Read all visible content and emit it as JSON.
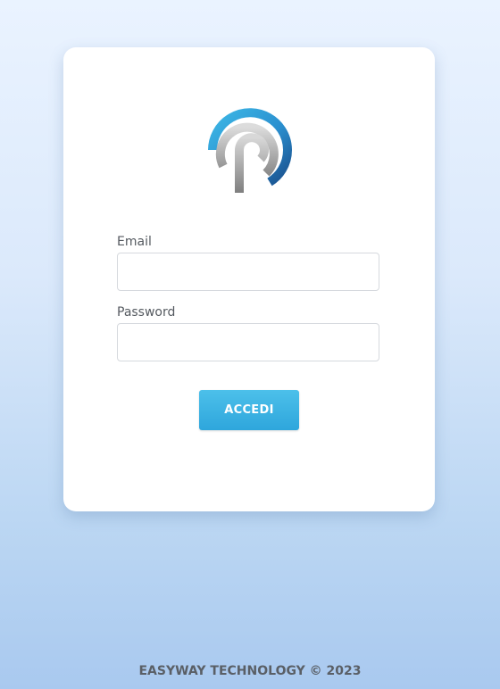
{
  "login": {
    "email_label": "Email",
    "email_value": "",
    "password_label": "Password",
    "password_value": "",
    "submit_label": "ACCEDI"
  },
  "footer": {
    "text": "EASYWAY TECHNOLOGY © 2023"
  },
  "brand": {
    "logo_icon": "easyway-p-logo-icon",
    "colors": {
      "accent": "#2ea6dc",
      "logo_blue_light": "#3db8e6",
      "logo_blue_dark": "#1a4f8c",
      "logo_gray": "#9a9a9a"
    }
  }
}
